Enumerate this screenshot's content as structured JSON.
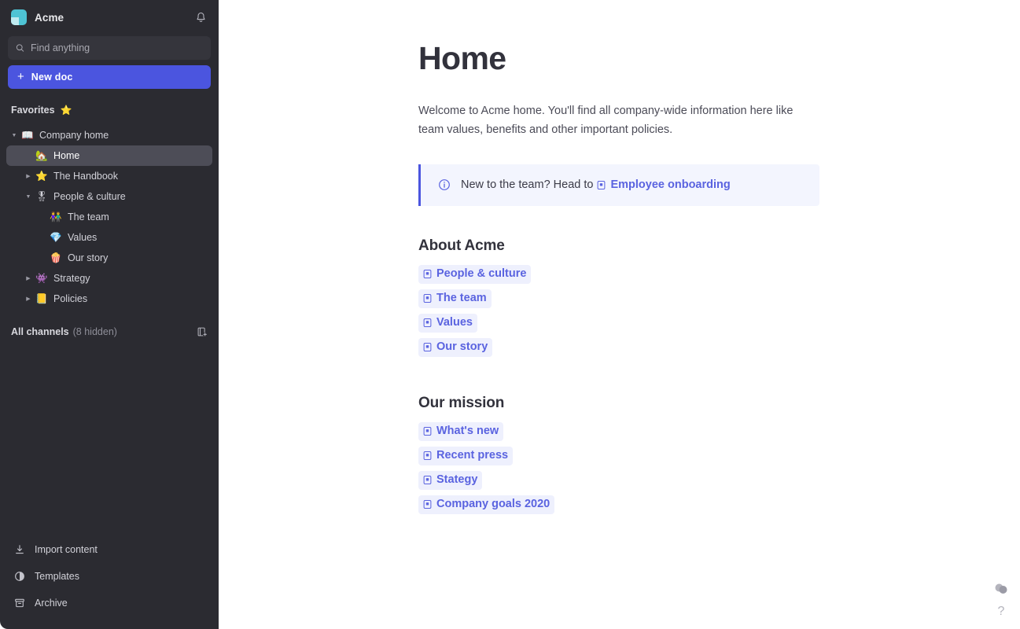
{
  "sidebar": {
    "brand": {
      "name": "Acme",
      "logo_icon": "acme-logo",
      "accent": "#4ec3d4"
    },
    "notifications_icon": "bell-icon",
    "search": {
      "placeholder": "Find anything",
      "value": "",
      "icon": "search-icon"
    },
    "new_doc": {
      "label": "New doc",
      "icon": "plus-icon",
      "color": "#4b55df"
    },
    "favorites": {
      "label": "Favorites",
      "emoji": "⭐"
    },
    "tree": [
      {
        "label": "Company home",
        "emoji": "📖",
        "depth": 0,
        "caret": "down",
        "active": false
      },
      {
        "label": "Home",
        "emoji": "🏡",
        "depth": 1,
        "caret": "none",
        "active": true
      },
      {
        "label": "The Handbook",
        "emoji": "⭐",
        "depth": 1,
        "caret": "right",
        "active": false
      },
      {
        "label": "People & culture",
        "emoji": "🎖",
        "depth": 1,
        "caret": "down",
        "active": false
      },
      {
        "label": "The team",
        "emoji": "👫",
        "depth": 2,
        "caret": "none",
        "active": false
      },
      {
        "label": "Values",
        "emoji": "💎",
        "depth": 2,
        "caret": "none",
        "active": false
      },
      {
        "label": "Our story",
        "emoji": "🍿",
        "depth": 2,
        "caret": "none",
        "active": false
      },
      {
        "label": "Strategy",
        "emoji": "👾",
        "depth": 1,
        "caret": "right",
        "active": false
      },
      {
        "label": "Policies",
        "emoji": "📒",
        "depth": 1,
        "caret": "right",
        "active": false
      }
    ],
    "all_channels": {
      "label": "All channels",
      "hidden_count": "(8 hidden)",
      "add_icon": "new-channel-icon"
    },
    "bottom_items": [
      {
        "label": "Import content",
        "icon": "download-icon"
      },
      {
        "label": "Templates",
        "icon": "template-icon"
      },
      {
        "label": "Archive",
        "icon": "archive-icon"
      }
    ]
  },
  "main": {
    "title": "Home",
    "intro": "Welcome to Acme home. You'll find all company-wide information here like team values, benefits and other important policies.",
    "callout": {
      "icon": "info-circle-icon",
      "text": "New to the team? Head to",
      "link_label": "Employee onboarding",
      "link_icon": "doc-icon",
      "accent": "#4b55df",
      "background": "#f3f5fe"
    },
    "sections": [
      {
        "heading": "About Acme",
        "links": [
          {
            "label": "People & culture",
            "icon": "doc-icon"
          },
          {
            "label": "The team",
            "icon": "doc-icon"
          },
          {
            "label": "Values",
            "icon": "doc-icon"
          },
          {
            "label": "Our story",
            "icon": "doc-icon"
          }
        ]
      },
      {
        "heading": "Our mission",
        "links": [
          {
            "label": "What's new",
            "icon": "doc-icon"
          },
          {
            "label": "Recent press",
            "icon": "doc-icon"
          },
          {
            "label": "Stategy",
            "icon": "doc-icon"
          },
          {
            "label": "Company goals 2020",
            "icon": "doc-icon"
          }
        ]
      }
    ],
    "helpers": {
      "feedback_icon": "feedback-blobs-icon",
      "help_label": "?"
    }
  }
}
